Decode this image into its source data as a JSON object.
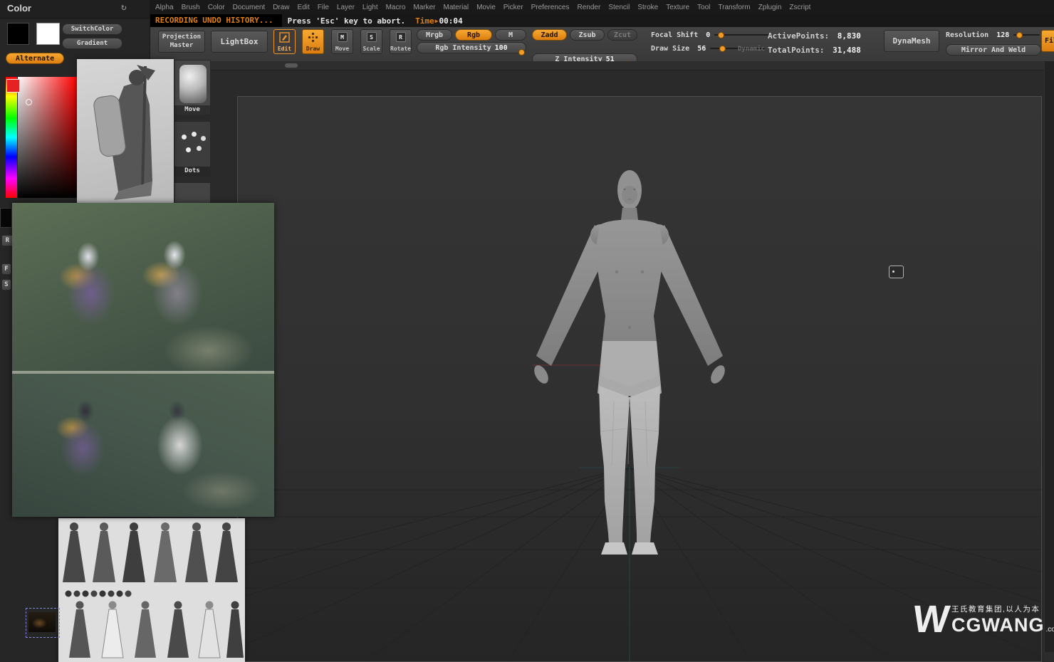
{
  "menu": {
    "items": [
      "Alpha",
      "Brush",
      "Color",
      "Document",
      "Draw",
      "Edit",
      "File",
      "Layer",
      "Light",
      "Macro",
      "Marker",
      "Material",
      "Movie",
      "Picker",
      "Preferences",
      "Render",
      "Stencil",
      "Stroke",
      "Texture",
      "Tool",
      "Transform",
      "Zplugin",
      "Zscript"
    ]
  },
  "recording": {
    "message": "RECORDING UNDO HISTORY...",
    "hint": "Press 'Esc' key to abort.",
    "time_label": "Time",
    "time_arrow": "▶",
    "time_value": "00:04"
  },
  "color_panel": {
    "title": "Color",
    "switch_color": "SwitchColor",
    "gradient": "Gradient",
    "alternate": "Alternate",
    "fragments": [
      "R",
      "F",
      "S"
    ]
  },
  "tool_thumbs": {
    "move": "Move",
    "dots": "Dots"
  },
  "toolbar": {
    "projection_master": "Projection Master",
    "lightbox": "LightBox",
    "edit": "Edit",
    "draw": "Draw",
    "move": "Move",
    "scale": "Scale",
    "rotate": "Rotate",
    "mrgb": "Mrgb",
    "rgb": "Rgb",
    "m": "M",
    "rgb_intensity_label": "Rgb Intensity",
    "rgb_intensity_value": "100",
    "zadd": "Zadd",
    "zsub": "Zsub",
    "zcut": "Zcut",
    "z_intensity_label": "Z Intensity",
    "z_intensity_value": "51",
    "focal_shift_label": "Focal Shift",
    "focal_shift_value": "0",
    "draw_size_label": "Draw Size",
    "draw_size_value": "56",
    "dynamic": "Dynamic",
    "active_points_label": "ActivePoints:",
    "active_points_value": "8,830",
    "total_points_label": "TotalPoints:",
    "total_points_value": "31,488",
    "dynamesh": "DynaMesh",
    "resolution_label": "Resolution",
    "resolution_value": "128",
    "mirror_and_weld": "Mirror And Weld",
    "fill": "Fill"
  },
  "icons": {
    "refresh": "↻",
    "move_badge": "M",
    "scale_badge": "S",
    "rotate_badge": "R"
  },
  "watermark": {
    "logo": "W",
    "line1": "王氏教育集团,以人为本",
    "brand": "CGWANG",
    "tld": ".com"
  }
}
